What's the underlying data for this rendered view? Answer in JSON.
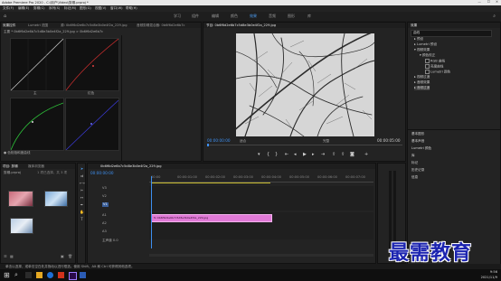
{
  "titlebar": {
    "title": "Adobe Premiere Pro 2020 - C:\\用户\\Video\\剪辑.prproj *"
  },
  "menu": [
    "文件(F)",
    "编辑(E)",
    "剪辑(C)",
    "序列(S)",
    "标记(M)",
    "图形(G)",
    "视图(V)",
    "窗口(W)",
    "帮助(H)"
  ],
  "workspaces": [
    "学习",
    "组件",
    "编辑",
    "颜色",
    "效果",
    "音频",
    "图形",
    "库"
  ],
  "active_workspace": "效果",
  "left_panel": {
    "tabs": [
      "效果控件",
      "Lumetri 范围",
      "源: 0b6f6d2e6b7c5d8e3b0e4f2a_229.jpg",
      "音频剪辑混合器: 0b6f6d2e6b7c"
    ],
    "clip": "主要 * 0b6f6d2e6b7c5d8e3b0e4f2a_229.jpg > 0b6f6d2e6b7c",
    "curve_labels": [
      "主",
      "红色",
      "绿色",
      "蓝色"
    ],
    "footer": "● 色相饱和度曲线"
  },
  "program": {
    "tab": "节目: 0b6f6d2e6b7c5d8e3b0e4f2a_229.jpg",
    "timecode": "00:00:00:00",
    "fit": "适合",
    "quality": "完整",
    "duration": "00:00:05:00"
  },
  "effects": {
    "tab": "效果",
    "search": "曲线",
    "tree": [
      "预设",
      "Lumetri 预设",
      "视频效果",
      "颜色校正",
      "RGB 曲线",
      "亮度曲线",
      "Lumetri 颜色",
      "视频过渡",
      "音频效果",
      "音频过渡",
      "RGB 曲线"
    ],
    "sections": [
      "基本图形",
      "基本声音",
      "Lumetri 颜色",
      "库",
      "标记",
      "历史记录",
      "信息"
    ]
  },
  "project": {
    "tabs": [
      "项目: 剪辑",
      "媒体浏览器"
    ],
    "file": "剪辑.prproj",
    "count": "1 项已选择，共 3 项"
  },
  "timeline": {
    "tab": "0b6f6d2e6b7c5d8e3b0e4f2a_229.jpg",
    "timecode": "00:00:00:00",
    "ruler": [
      "00:00",
      "00:00:01:00",
      "00:00:02:00",
      "00:00:03:00",
      "00:00:04:00",
      "00:00:05:00",
      "00:00:06:00",
      "00:00:07:00"
    ],
    "tracks": [
      "V3",
      "V2",
      "V1",
      "A1",
      "A2",
      "A3"
    ],
    "clip": "fx 0b6f6d2e6b7c5d8e3b0e4f2a_229.jpg",
    "master": "主声道 0.0"
  },
  "status": "单击以选择，或单击空白处并拖动以进行框选。使用 Shift、Alt 和 Ctrl 可获得其他选项。",
  "watermark": "最需教育",
  "taskbar": {
    "time": "9:56",
    "date": "2021/11/9"
  }
}
